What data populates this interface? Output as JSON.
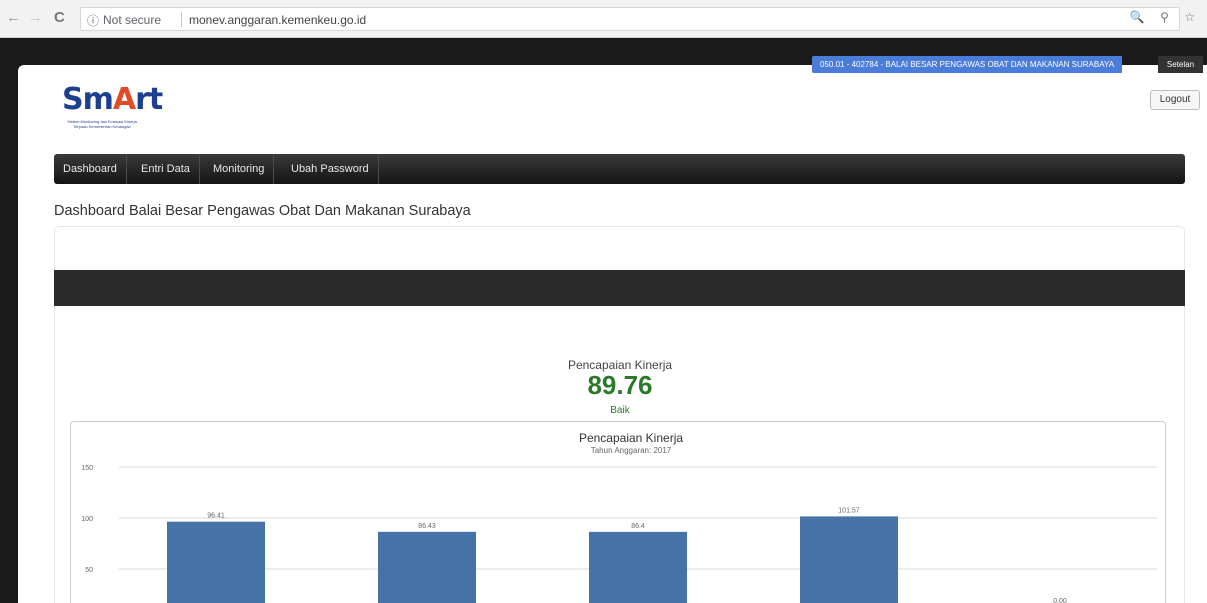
{
  "browser": {
    "back": "←",
    "forward": "→",
    "reload": "C",
    "security": "Not secure",
    "url": "monev.anggaran.kemenkeu.go.id",
    "right_icons": "🔍 ⚲ ☆"
  },
  "app": {
    "logo_main": "Sm",
    "logo_accent": "A",
    "logo_rest": "rt",
    "logo_sub": "Sistem Monitoring dan Evaluasi Kinerja Terpadu Kementerian Keuangan",
    "user_info": "050.01 - 402784 - BALAI BESAR PENGAWAS OBAT DAN MAKANAN SURABAYA",
    "settings_label": "Setelan",
    "logout_label": "Logout"
  },
  "menu": [
    {
      "label": "Dashboard"
    },
    {
      "label": "Entri Data"
    },
    {
      "label": "Monitoring"
    },
    {
      "label": "Ubah Password"
    }
  ],
  "page_title": "Dashboard Balai Besar Pengawas Obat Dan Makanan Surabaya",
  "kpi": {
    "label": "Pencapaian Kinerja",
    "value": "89.76",
    "status": "Baik",
    "value_color": "#2a7a2a"
  },
  "chart_data": {
    "type": "bar",
    "title": "Pencapaian Kinerja",
    "subtitle": "Tahun Anggaran: 2017",
    "categories": [
      "",
      "",
      "",
      "",
      ""
    ],
    "values": [
      96.41,
      86.43,
      86.4,
      101.57,
      0
    ],
    "data_labels": [
      "96.41",
      "86.43",
      "86.4",
      "101.57",
      "0.00"
    ],
    "yticks": [
      150,
      100,
      50
    ],
    "ylim": [
      0,
      150
    ],
    "bar_color": "#4572a7",
    "grid": true
  }
}
